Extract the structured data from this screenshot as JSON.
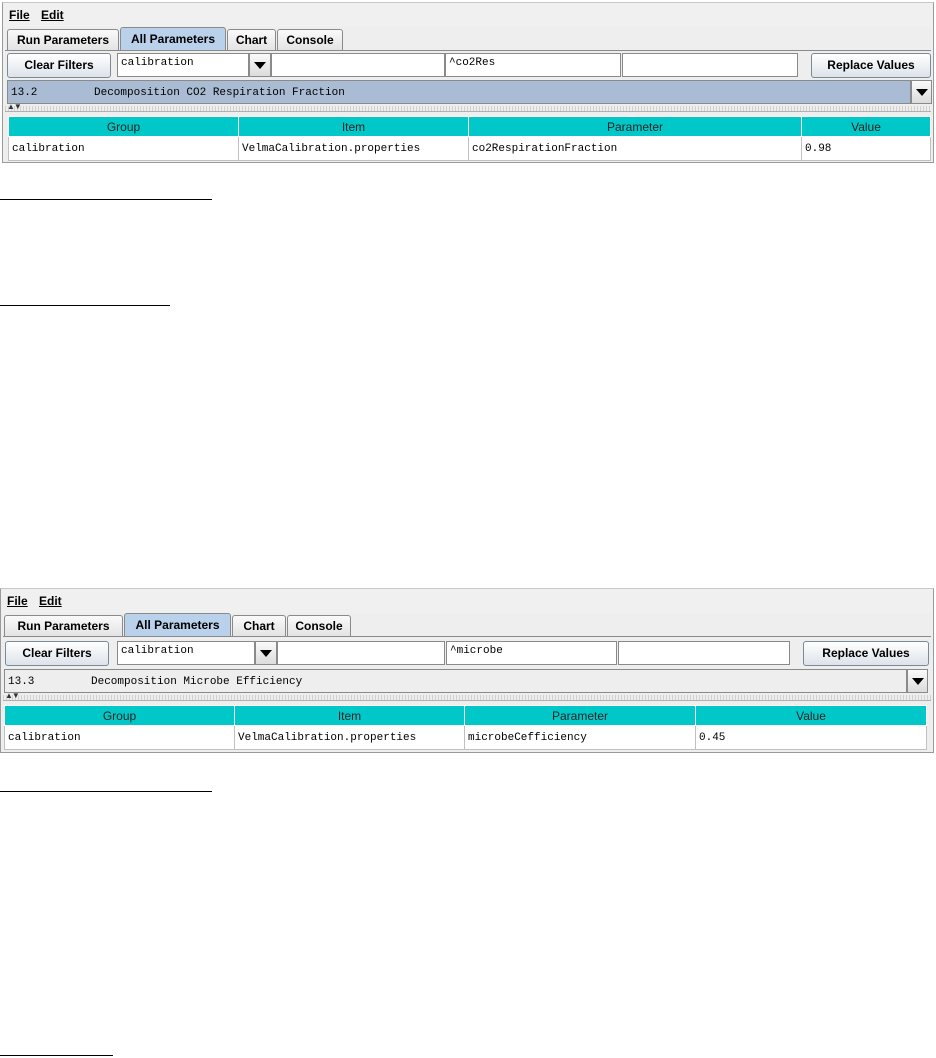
{
  "screen1": {
    "menu": {
      "file": "File",
      "edit": "Edit"
    },
    "tabs": [
      "Run Parameters",
      "All Parameters",
      "Chart",
      "Console"
    ],
    "active_tab": "All Parameters",
    "toolbar": {
      "clear_filters": "Clear Filters",
      "group_filter": "calibration",
      "item_filter": "",
      "param_filter": "^co2Res",
      "value_filter": "",
      "replace_values": "Replace Values"
    },
    "selection": {
      "number": "13.2",
      "description": "Decomposition CO2 Respiration Fraction"
    },
    "table": {
      "headers": [
        "Group",
        "Item",
        "Parameter",
        "Value"
      ],
      "rows": [
        [
          "calibration",
          "VelmaCalibration.properties",
          "co2RespirationFraction",
          "0.98"
        ]
      ]
    }
  },
  "screen2": {
    "menu": {
      "file": "File",
      "edit": "Edit"
    },
    "tabs": [
      "Run Parameters",
      "All Parameters",
      "Chart",
      "Console"
    ],
    "active_tab": "All Parameters",
    "toolbar": {
      "clear_filters": "Clear Filters",
      "group_filter": "calibration",
      "item_filter": "",
      "param_filter": "^microbe",
      "value_filter": "",
      "replace_values": "Replace Values"
    },
    "selection": {
      "number": "13.3",
      "description": "Decomposition Microbe Efficiency"
    },
    "table": {
      "headers": [
        "Group",
        "Item",
        "Parameter",
        "Value"
      ],
      "rows": [
        [
          "calibration",
          "VelmaCalibration.properties",
          "microbeCefficiency",
          "0.45"
        ]
      ]
    }
  },
  "colors": {
    "header_cyan": "#00c8c8",
    "selection_blue": "#a9bcd3",
    "active_tab": "#b9d1ea"
  }
}
